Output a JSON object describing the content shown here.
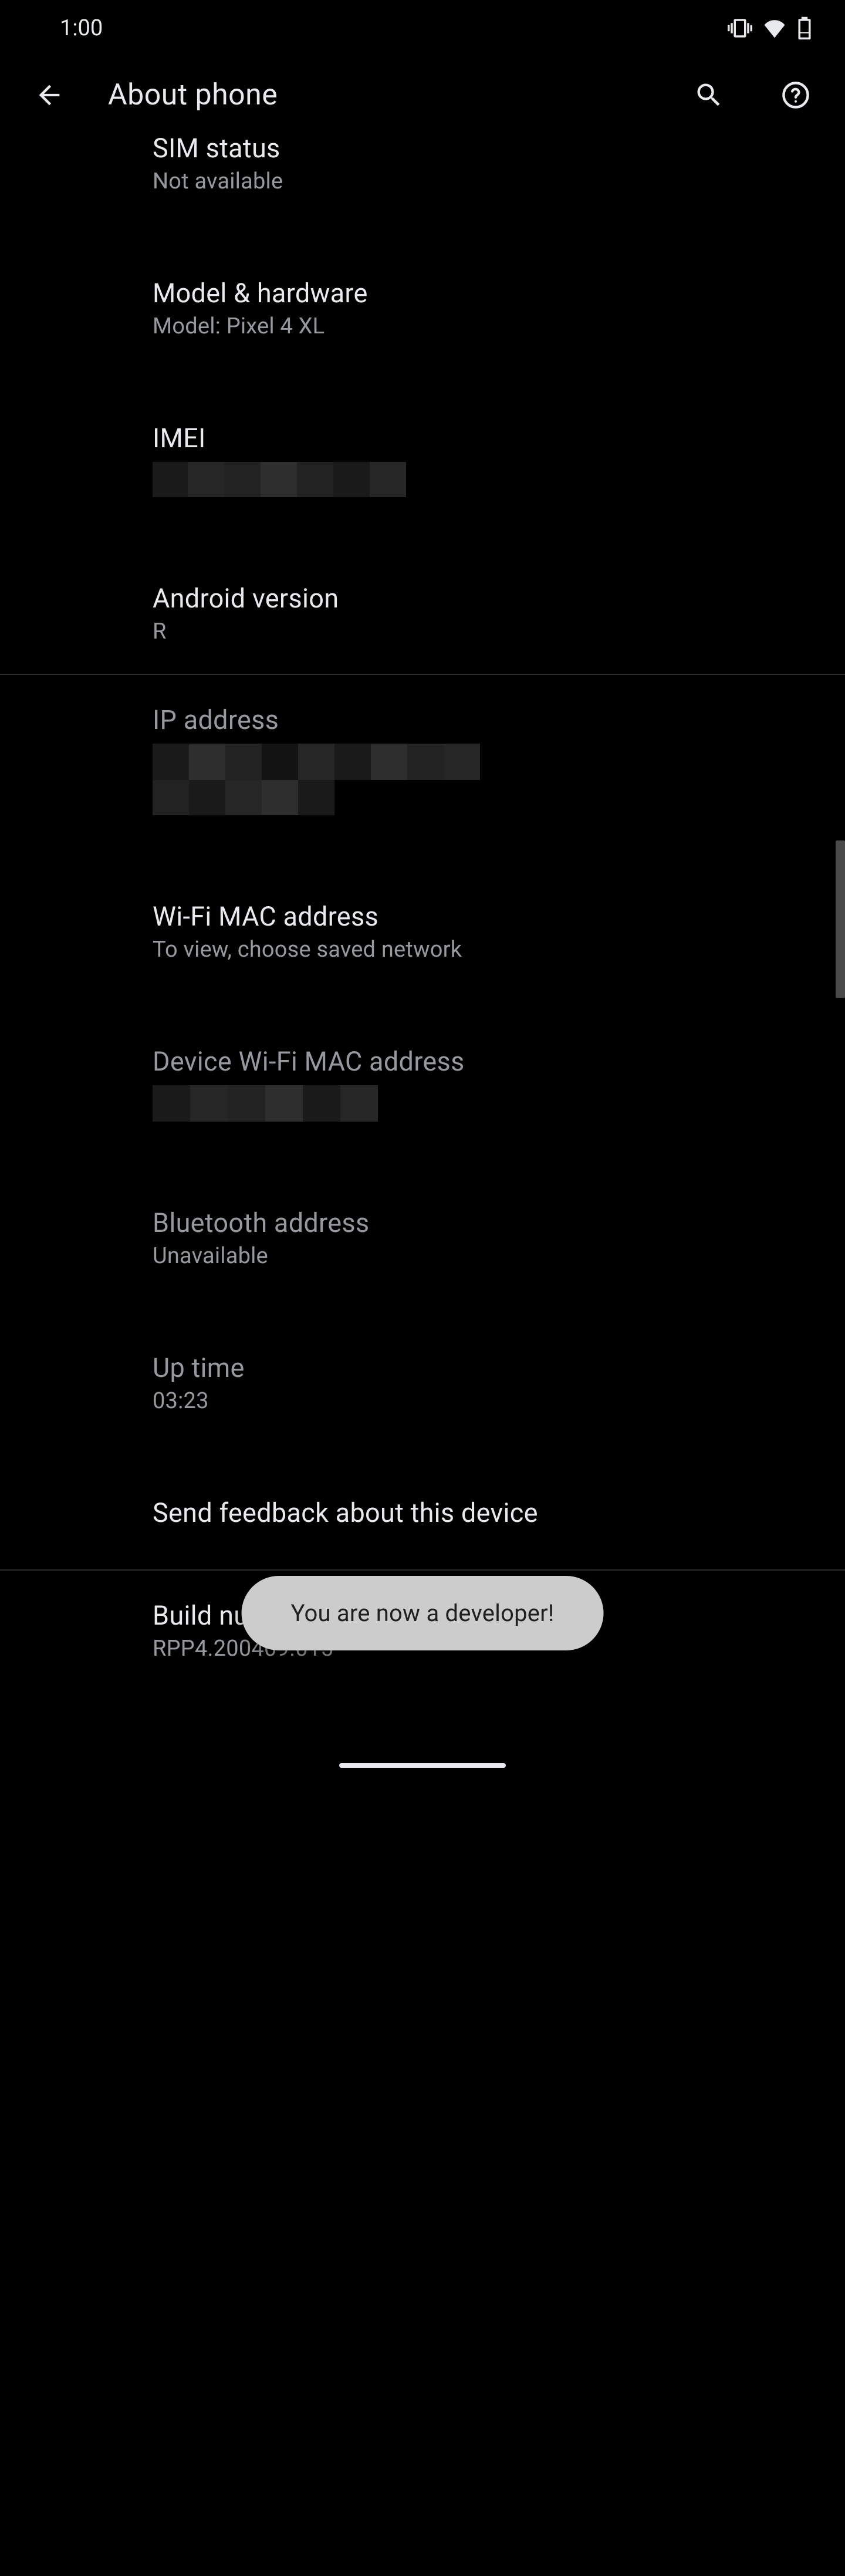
{
  "status_bar": {
    "time": "1:00"
  },
  "header": {
    "title": "About phone"
  },
  "items": [
    {
      "title": "SIM status",
      "value": "Not available",
      "clickable": true,
      "dimmed": false
    },
    {
      "title": "Model & hardware",
      "value": "Model: Pixel 4 XL",
      "clickable": true,
      "dimmed": false
    },
    {
      "title": "IMEI",
      "value": "REDACTED",
      "clickable": true,
      "dimmed": false
    },
    {
      "title": "Android version",
      "value": "R",
      "clickable": true,
      "dimmed": false
    },
    {
      "title": "IP address",
      "value": "REDACTED",
      "clickable": false,
      "dimmed": true
    },
    {
      "title": "Wi-Fi MAC address",
      "value": "To view, choose saved network",
      "clickable": true,
      "dimmed": false
    },
    {
      "title": "Device Wi-Fi MAC address",
      "value": "REDACTED",
      "clickable": false,
      "dimmed": true
    },
    {
      "title": "Bluetooth address",
      "value": "Unavailable",
      "clickable": false,
      "dimmed": true
    },
    {
      "title": "Up time",
      "value": "03:23",
      "clickable": false,
      "dimmed": true
    },
    {
      "title": "Send feedback about this device",
      "value": "",
      "clickable": true,
      "dimmed": false
    },
    {
      "title": "Build number",
      "value": "RPP4.200409.015",
      "clickable": true,
      "dimmed": false
    }
  ],
  "toast": {
    "message": "You are now a developer!"
  }
}
